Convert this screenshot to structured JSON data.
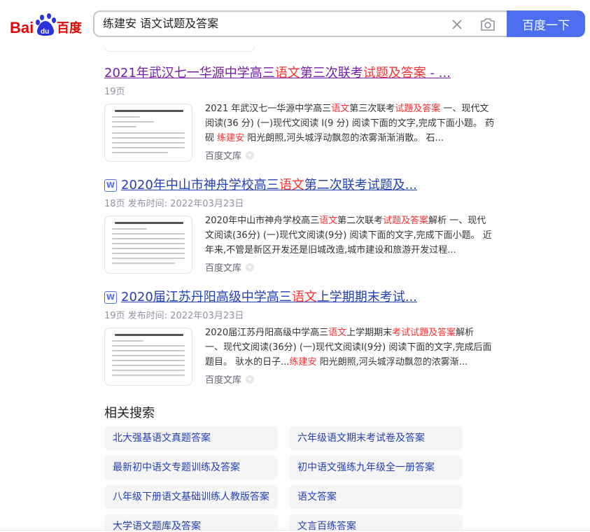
{
  "header": {
    "logo_text_left": "Bai",
    "logo_text_right": "百度",
    "search_value": "练建安 语文试题及答案",
    "search_button": "百度一下"
  },
  "results": [
    {
      "title_parts": [
        "2021年武汉七一华源中学高三",
        "语文",
        "第三次联考",
        "试题及答案",
        " - ..."
      ],
      "meta": "19页",
      "snippet_parts": [
        "2021 年武汉七一华源中学高三",
        "语文",
        "第三次联考",
        "试题及答案",
        " 一、现代文阅读(36 分) (一)现代文阅读 I(9 分) 阅读下面的文字,完成下面小题。 药砚 ",
        "练建安",
        " 阳光朗照,河头城浮动飘忽的浓雾渐渐消散。 石..."
      ],
      "source": "百度文库"
    },
    {
      "title_parts": [
        "2020年中山市神舟学校高三",
        "语文",
        "第二次联考试题及..."
      ],
      "meta": "18页 发布时间: 2022年03月23日",
      "snippet_parts": [
        "2020年中山市神舟学校高三",
        "语文",
        "第二次联考",
        "试题及答案",
        "解析 一、现代文阅读(36分) (一)现代文阅读(9分) 阅读下面的文字,完成下面小题。 近年来,不管是新区开发还是旧城改造,城市建设和旅游开发过程..."
      ],
      "source": "百度文库"
    },
    {
      "title_parts": [
        "2020届江苏丹阳高级中学高三",
        "语文",
        "上学期期末考试..."
      ],
      "meta": "19页 发布时间: 2022年03月23日",
      "snippet_parts": [
        "2020届江苏丹阳高级中学高三",
        "语文",
        "上学期期末",
        "考试试题及答案",
        "解析 一、现代文阅读(36分) (一)现代文阅读I(9分) 阅读下面的文字,完成后面题目。 驮水的日子...",
        "练建安",
        " 阳光朗照,河头城浮动飘忽的浓雾渐..."
      ],
      "source": "百度文库"
    }
  ],
  "word_icon": "W",
  "related": {
    "title": "相关搜索",
    "items": [
      "北大强基语文真题答案",
      "六年级语文期末考试卷及答案",
      "最新初中语文专题训练及答案",
      "初中语文强练九年级全一册答案",
      "八年级下册语文基础训练人教版答案",
      "语文答案",
      "大学语文题库及答案",
      "文言百练答案"
    ]
  },
  "colors": {
    "link": "#2440b3",
    "visited": "#771caa",
    "highlight": "#f73131",
    "brand_blue": "#4e6ef2",
    "brand_red": "#e10602"
  }
}
